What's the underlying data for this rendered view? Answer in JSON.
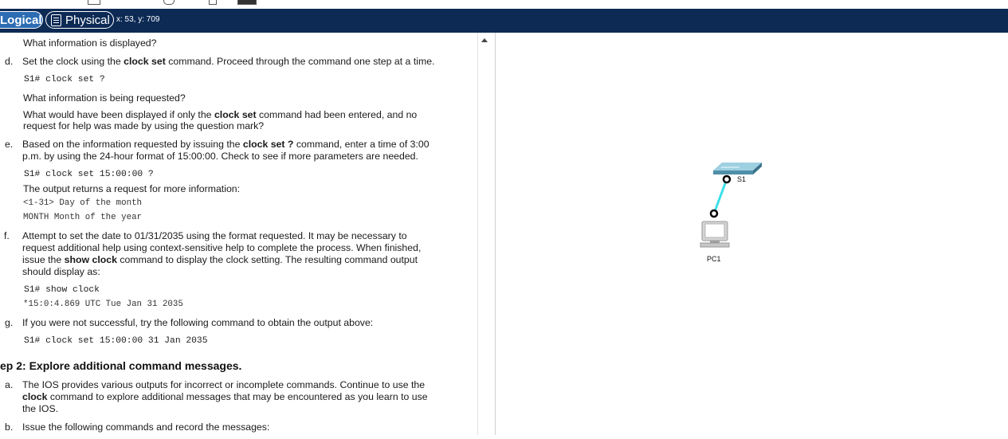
{
  "tabs": {
    "logical": "Logical",
    "physical": "Physical"
  },
  "coords": "x: 53, y: 709",
  "doc": {
    "l1": "What information is displayed?",
    "d_letter": "d.",
    "d_pre": "Set the clock using the ",
    "d_b": "clock set",
    "d_post": " command. Proceed through the command one step at a time.",
    "cmd1": "S1# clock set ?",
    "l_req": "What information is being requested?",
    "l_w1_pre": "What would have been displayed if only the ",
    "l_w1_b": "clock set",
    "l_w1_post": " command had been entered, and no",
    "l_w2": "request for help was made by using the question mark?",
    "e_letter": "e.",
    "e1_pre": "Based on the information requested by issuing the ",
    "e1_b": "clock set ?",
    "e1_post": " command, enter a time of 3:00",
    "e2": "p.m. by using the 24-hour format of 15:00:00. Check to see if more parameters are needed.",
    "cmd2": "S1# clock set 15:00:00 ?",
    "out_intro": "The output returns a request for more information:",
    "out1": "<1-31> Day of the month",
    "out2": "MONTH Month of the year",
    "f_letter": "f.",
    "f1": "Attempt to set the date to 01/31/2035 using the format requested. It may be necessary to",
    "f2": "request additional help using context-sensitive help to complete the process. When finished,",
    "f3_pre": "issue the ",
    "f3_b": "show clock",
    "f3_post": " command to display the clock setting. The resulting command output",
    "f4": "should display as:",
    "cmd3": "S1# show clock",
    "out3": "*15:0:4.869 UTC Tue Jan 31 2035",
    "g_letter": "g.",
    "g1": "If you were not successful, try the following command to obtain the output above:",
    "cmd4": "S1# clock set 15:00:00 31 Jan 2035",
    "step2": "ep 2: Explore additional command messages.",
    "a_letter": "a.",
    "a1": "The IOS provides various outputs for incorrect or incomplete commands. Continue to use the",
    "a2_b": "clock",
    "a2_post": " command to explore additional messages that may be encountered as you learn to use",
    "a3": "the IOS.",
    "b_letter": "b.",
    "b1": "Issue the following commands and record the messages:"
  },
  "topology": {
    "switch_label": "S1",
    "pc_label": "PC1",
    "link_color": "#3ee0e8",
    "switch_color": "#4f8fa8"
  }
}
